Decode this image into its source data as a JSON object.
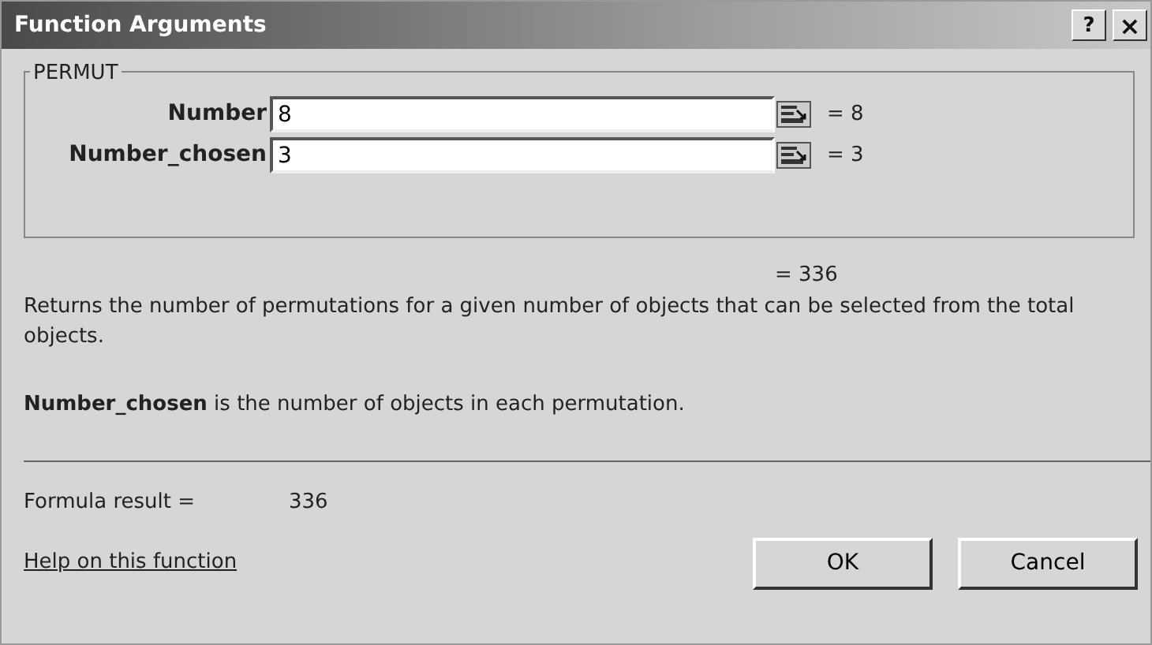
{
  "window": {
    "title": "Function Arguments",
    "buttons": [
      {
        "kind": "help",
        "label": "?"
      },
      {
        "kind": "close",
        "label": "×"
      }
    ]
  },
  "function_group": {
    "name": "PERMUT",
    "arguments": [
      {
        "label": "Number",
        "value": "8",
        "result": "= 8"
      },
      {
        "label": "Number_chosen",
        "value": "3",
        "result": "= 3"
      }
    ]
  },
  "function_result": "= 336",
  "description": "Returns the number of permutations for a given number of objects that can be selected from the total objects.",
  "argument_help": "**Number_chosen** is the number of objects in each permutation.",
  "formula_result": {
    "label": "Formula result =",
    "value": "336"
  },
  "help_link": "Help on this function",
  "buttons": [
    "OK",
    "Cancel"
  ]
}
